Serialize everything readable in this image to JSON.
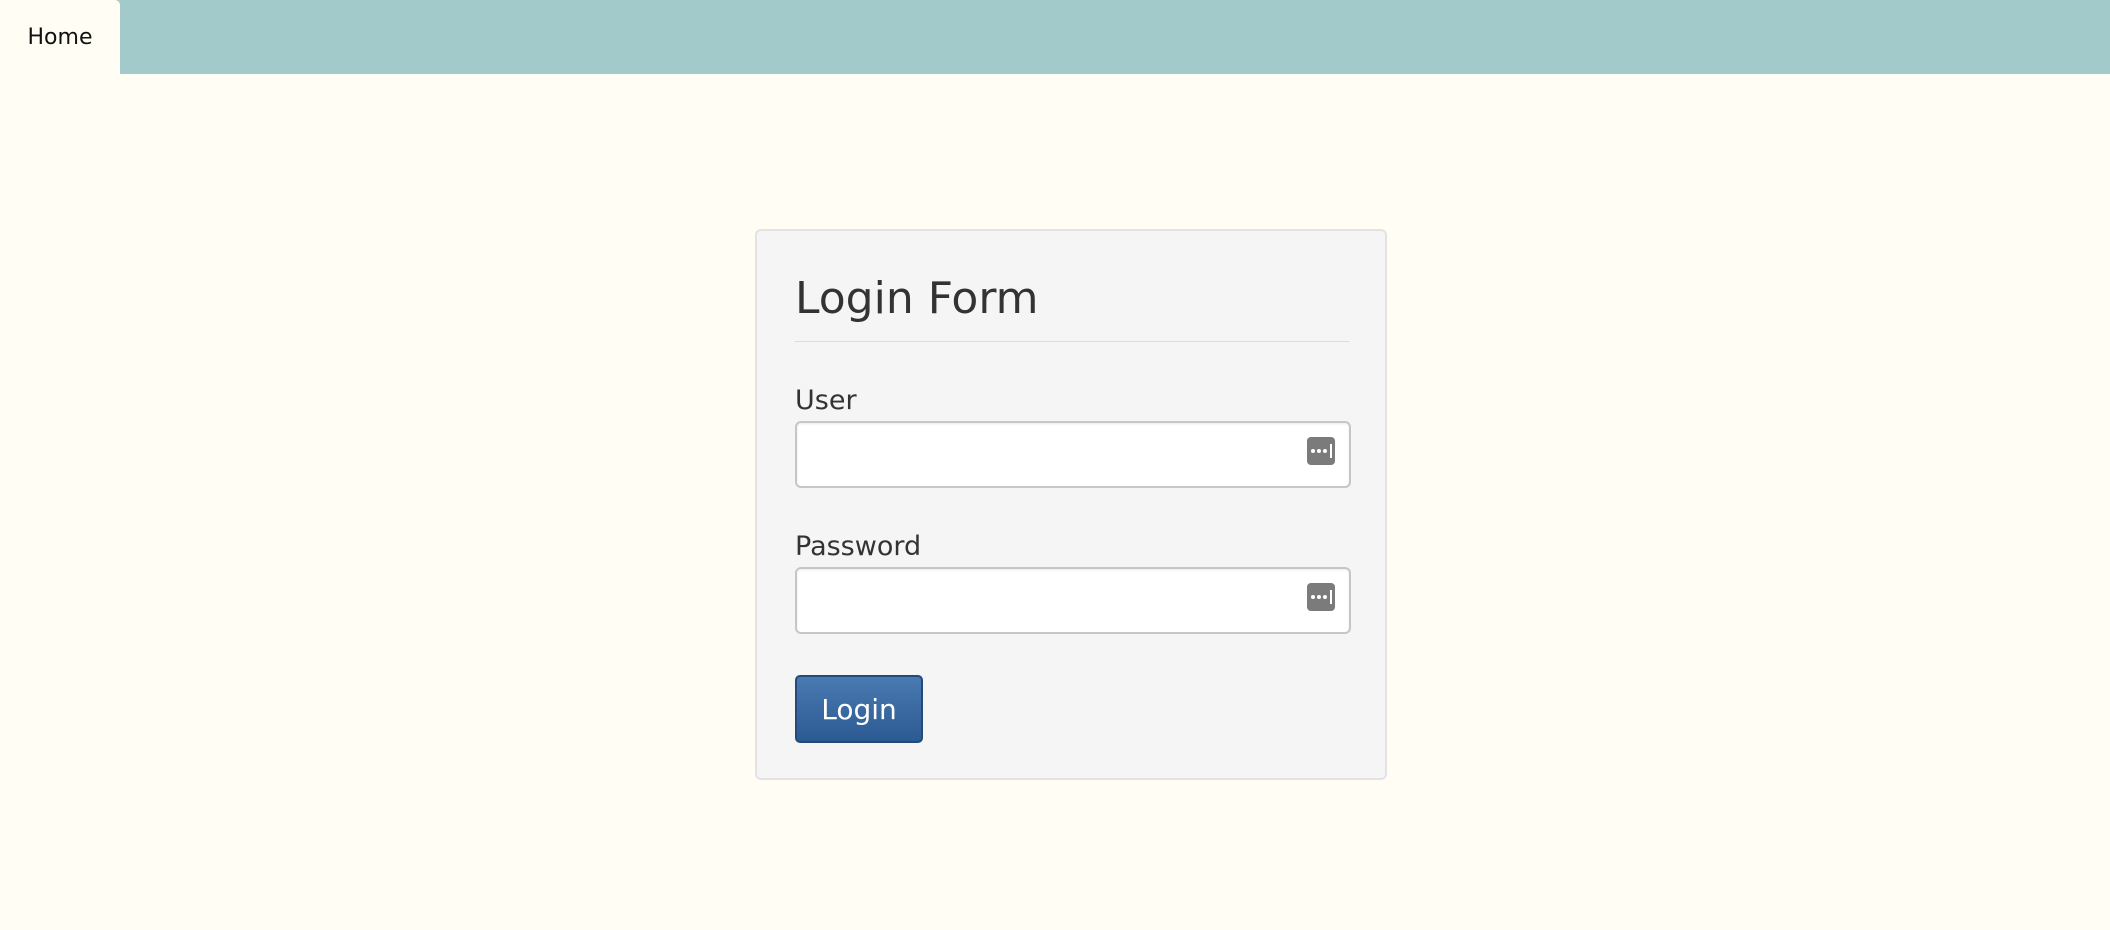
{
  "nav": {
    "home_label": "Home"
  },
  "login_form": {
    "title": "Login Form",
    "user_label": "User",
    "user_value": "",
    "password_label": "Password",
    "password_value": "",
    "submit_label": "Login",
    "field_icon": "password-manager-key-icon"
  },
  "colors": {
    "topbar": "#a3cacb",
    "background": "#fffdf4",
    "panel": "#f5f5f5",
    "button": "#2c5a93"
  }
}
